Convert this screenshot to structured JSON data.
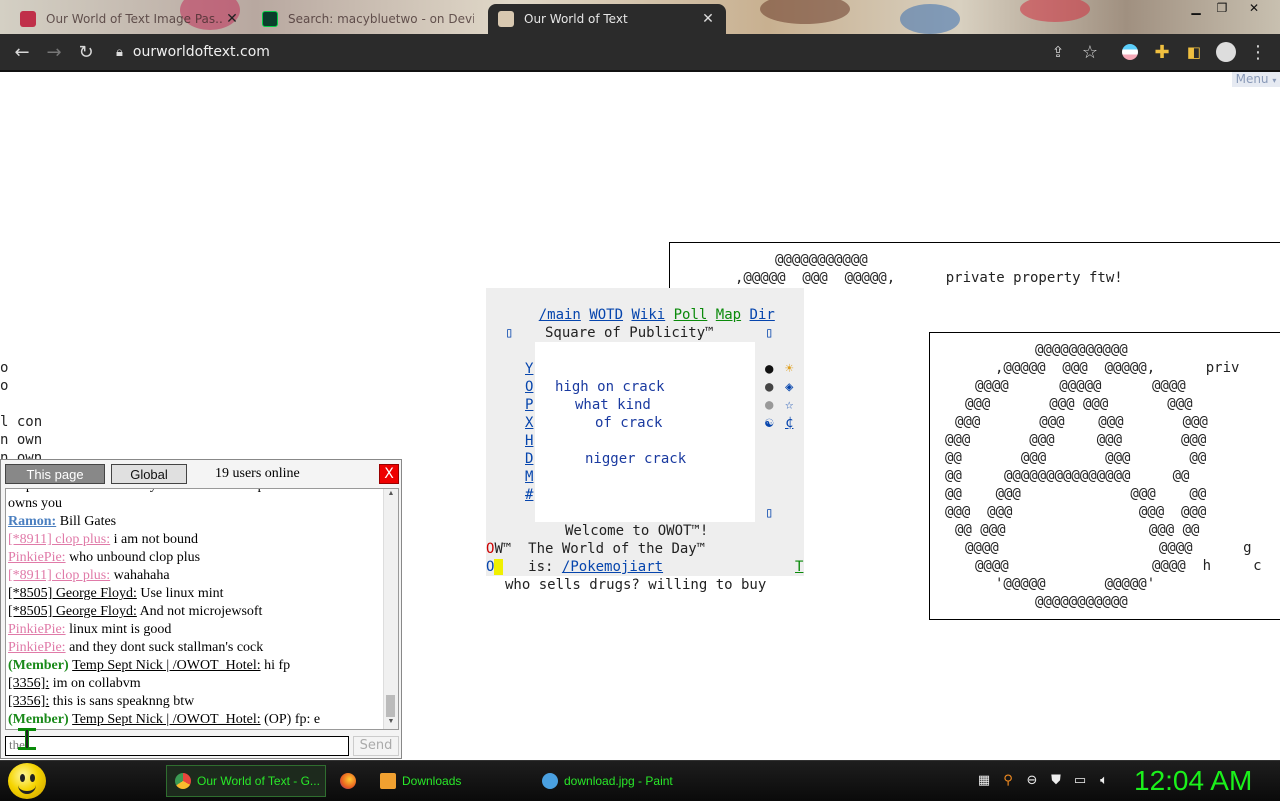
{
  "browser": {
    "tabs": [
      {
        "label": "Our World of Text Image Pas...",
        "active": false
      },
      {
        "label": "Search: macybluetwo - on Devia...",
        "active": false
      },
      {
        "label": "Our World of Text",
        "active": true
      }
    ],
    "tab_close_glyph": "✕",
    "url": "ourworldoftext.com",
    "menu_label": "Menu"
  },
  "canvas": {
    "top_right": {
      "line1": "@@@@@@@@@@@",
      "line2": ",@@@@@  @@@  @@@@@,      private property ftw!"
    },
    "portal": {
      "nav": [
        "/main",
        "WOTD",
        "Wiki",
        "Poll",
        "Map",
        "Dir"
      ],
      "nav_green": [
        "Poll",
        "Map",
        "Dir"
      ],
      "title": "Square of Publicity™",
      "left_letters": [
        "Y",
        "O",
        "P",
        "X",
        "H",
        "D",
        "M",
        "#"
      ],
      "right_symbols": [
        "●",
        "●",
        "●",
        "☯"
      ],
      "right_links": [
        "☀",
        "◈",
        "☆",
        "¢"
      ],
      "content": [
        "high on crack",
        "what kind",
        "of crack",
        "",
        "nigger crack"
      ],
      "welcome": "Welcome to OWOT™!",
      "wotd_prefix": "OW™",
      "wotd_label": "The World of the Day™",
      "is_prefix": "O",
      "is_label": "is:",
      "wotd_link": "/Pokemojiart",
      "wotd_right": "T",
      "below": "who sells drugs? willing to buy"
    },
    "left_edge": [
      "o",
      "o",
      "",
      "l con",
      "n own",
      "n own"
    ],
    "ascii_art": [
      "@@@@@@@@@@@",
      ",@@@@@  @@@  @@@@@,      priv",
      "@@@@      @@@@@      @@@@",
      "@@@       @@@ @@@       @@@",
      "@@@       @@@    @@@       @@@",
      "@@@       @@@     @@@       @@@",
      "@@       @@@       @@@       @@",
      "@@     @@@@@@@@@@@@@@@     @@",
      "@@    @@@             @@@    @@",
      "@@@  @@@               @@@  @@@",
      "@@ @@@                 @@@ @@",
      "@@@@                   @@@@      g",
      "@@@@                 @@@@  h     c",
      "'@@@@@       @@@@@'",
      "@@@@@@@@@@@"
    ]
  },
  "chat": {
    "tab_this_page": "This page",
    "tab_global": "Global",
    "users_online": "19 users online",
    "close_glyph": "X",
    "messages": [
      {
        "nick": "",
        "nick_style": "plain",
        "member": "",
        "text": "corporations will control your life forever capitalism"
      },
      {
        "nick": "",
        "nick_style": "plain",
        "member": "",
        "text": "owns you"
      },
      {
        "nick": "Ramon:",
        "nick_style": "blue",
        "member": "",
        "text": " Bill Gates"
      },
      {
        "nick": "[*8911] clop plus:",
        "nick_style": "pink",
        "member": "",
        "text": " i am not bound"
      },
      {
        "nick": "PinkiePie:",
        "nick_style": "pink",
        "member": "",
        "text": " who unbound clop plus"
      },
      {
        "nick": "[*8911] clop plus:",
        "nick_style": "pink",
        "member": "",
        "text": " wahahaha"
      },
      {
        "nick": "[*8505] George Floyd:",
        "nick_style": "plain",
        "member": "",
        "text": " Use linux mint"
      },
      {
        "nick": "[*8505] George Floyd:",
        "nick_style": "plain",
        "member": "",
        "text": " And not microjewsoft"
      },
      {
        "nick": "PinkiePie:",
        "nick_style": "pink",
        "member": "",
        "text": " linux mint is good"
      },
      {
        "nick": "PinkiePie:",
        "nick_style": "pink",
        "member": "",
        "text": " and they dont suck stallman's cock"
      },
      {
        "nick": "Temp Sept Nick | /OWOT_Hotel:",
        "nick_style": "plain",
        "member": "(Member) ",
        "text": " hi fp"
      },
      {
        "nick": "[3356]:",
        "nick_style": "plain",
        "member": "",
        "text": " im on collabvm"
      },
      {
        "nick": "[3356]:",
        "nick_style": "plain",
        "member": "",
        "text": " this is sans speaknng btw"
      },
      {
        "nick": "Temp Sept Nick | /OWOT_Hotel:",
        "nick_style": "plain",
        "member": "(Member) ",
        "text": " (OP) fp: e"
      }
    ],
    "input_value": "the",
    "send_label": "Send"
  },
  "taskbar": {
    "tasks": [
      {
        "label": "Our World of Text - G...",
        "icon_color": "#e8453c",
        "active": true
      },
      {
        "label": "Downloads",
        "icon_color": "#f0a030",
        "active": false
      },
      {
        "label": "download.jpg - Paint",
        "icon_color": "#4aa0e0",
        "active": false
      }
    ],
    "clock": "12:04 AM"
  },
  "colors": {
    "tab_active_bg": "#2b2b2b",
    "taskbar_text": "#29e829",
    "clock": "#1bf01b",
    "link_blue": "#0645ad",
    "link_green": "#0a8a0a"
  }
}
